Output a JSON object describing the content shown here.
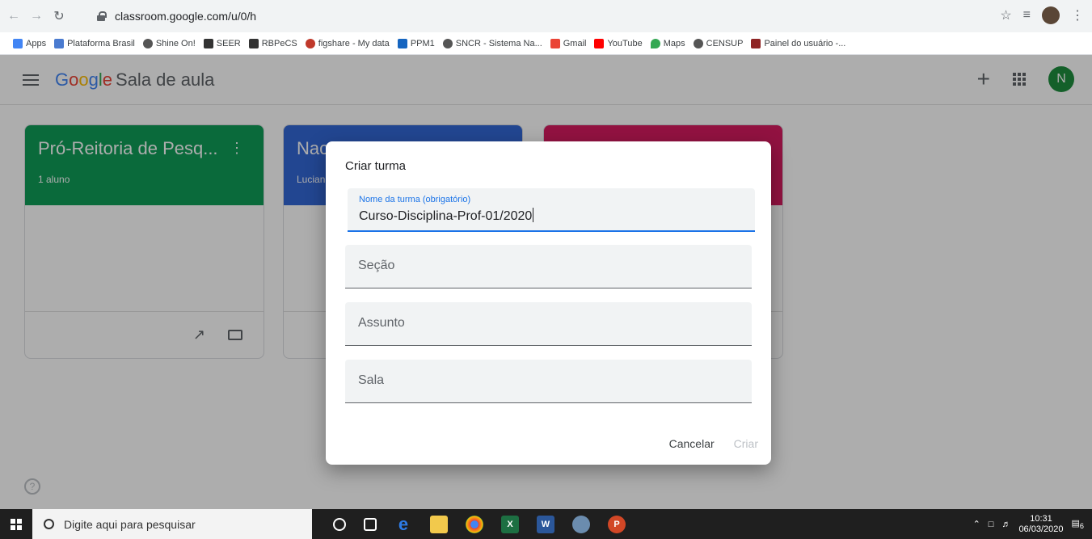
{
  "browser": {
    "url": "classroom.google.com/u/0/h",
    "bookmarks": [
      "Apps",
      "Plataforma Brasil",
      "Shine On!",
      "SEER",
      "RBPeCS",
      "figshare - My data",
      "PPM1",
      "SNCR - Sistema Na...",
      "Gmail",
      "YouTube",
      "Maps",
      "CENSUP",
      "Painel do usuário -..."
    ]
  },
  "app": {
    "logo_parts": [
      "G",
      "o",
      "o",
      "g",
      "l",
      "e"
    ],
    "name": "Sala de aula",
    "user_initial": "N"
  },
  "cards": [
    {
      "title": "Pró-Reitoria de Pesq...",
      "subtitle": "1 aluno",
      "color": "#0f9d58"
    },
    {
      "title": "Nac",
      "subtitle": "Lucian",
      "color": "#3367d6"
    },
    {
      "title": "",
      "subtitle": "",
      "color": "#d81b60"
    }
  ],
  "dialog": {
    "title": "Criar turma",
    "fields": {
      "name_label": "Nome da turma (obrigatório)",
      "name_value": "Curso-Disciplina-Prof-01/2020",
      "section_placeholder": "Seção",
      "subject_placeholder": "Assunto",
      "room_placeholder": "Sala"
    },
    "cancel_label": "Cancelar",
    "create_label": "Criar"
  },
  "taskbar": {
    "search_placeholder": "Digite aqui para pesquisar",
    "time": "10:31",
    "date": "06/03/2020",
    "notification_count": "6"
  }
}
